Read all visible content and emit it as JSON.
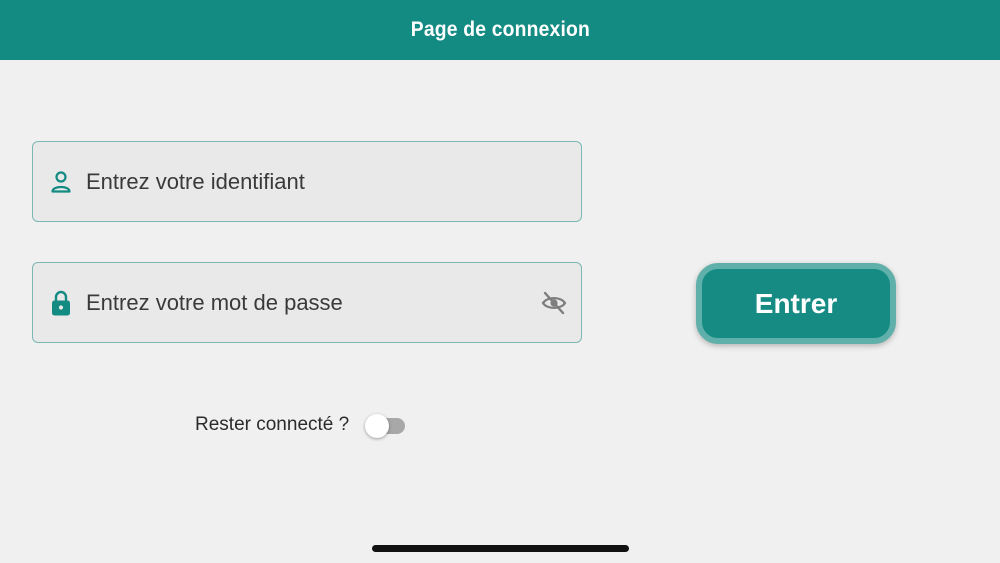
{
  "header": {
    "title": "Page de connexion"
  },
  "login_form": {
    "username": {
      "placeholder": "Entrez votre identifiant",
      "value": ""
    },
    "password": {
      "placeholder": "Entrez votre mot de passe",
      "value": ""
    },
    "submit_label": "Entrer",
    "remember": {
      "label": "Rester connecté ?",
      "enabled": false
    }
  },
  "icons": {
    "username": "person-icon",
    "password": "lock-icon",
    "visibility": "eye-off-icon"
  },
  "colors": {
    "accent": "#138a82",
    "button_border": "#5fb0aa",
    "field_border": "#7bb8b3",
    "background": "#f0f0f0"
  }
}
